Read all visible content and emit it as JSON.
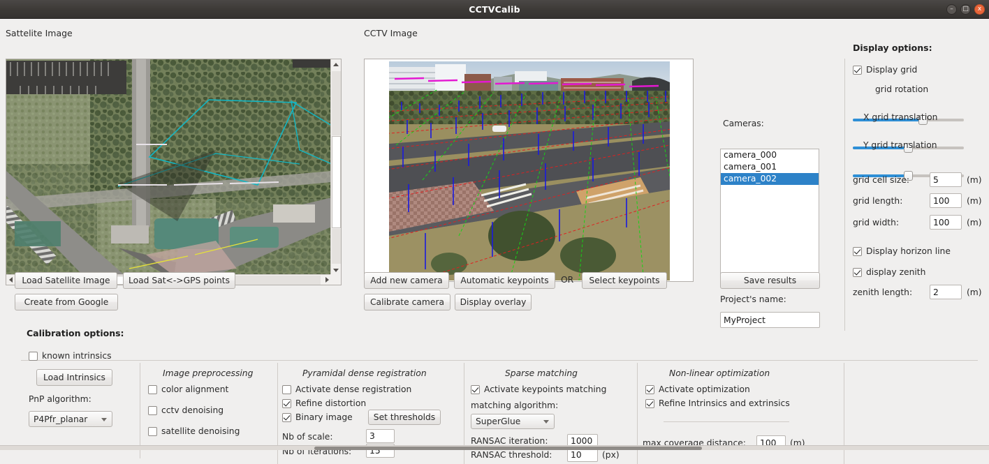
{
  "window": {
    "title": "CCTVCalib",
    "minimize_label": "–",
    "maximize_label": "□",
    "close_label": "x"
  },
  "satellite_panel": {
    "label": "Sattelite Image",
    "buttons": [
      {
        "name": "load-satellite-image-button",
        "label": "Load Satellite Image"
      },
      {
        "name": "load-sat-gps-points-button",
        "label": "Load Sat<->GPS points"
      },
      {
        "name": "create-from-google-button",
        "label": "Create from Google"
      }
    ]
  },
  "cctv_panel": {
    "label": "CCTV Image",
    "buttons": [
      {
        "name": "add-new-camera-button",
        "label": "Add new camera"
      },
      {
        "name": "automatic-keypoints-button",
        "label": "Automatic keypoints"
      },
      {
        "name": "select-keypoints-button",
        "label": "Select keypoints"
      },
      {
        "name": "calibrate-camera-button",
        "label": "Calibrate camera"
      },
      {
        "name": "display-overlay-button",
        "label": "Display overlay"
      }
    ],
    "or_text": "OR"
  },
  "cameras_panel": {
    "label": "Cameras:",
    "items": [
      {
        "label": "camera_000",
        "selected": false
      },
      {
        "label": "camera_001",
        "selected": false
      },
      {
        "label": "camera_002",
        "selected": true
      }
    ],
    "save_results_label": "Save results",
    "project_name_label": "Project's name:",
    "project_name_value": "MyProject"
  },
  "display_options": {
    "title": "Display options:",
    "display_grid": {
      "label": "Display grid",
      "checked": true
    },
    "grid_rotation": {
      "label": "grid rotation",
      "value_pct": 64
    },
    "x_grid_translation": {
      "label": "X grid translation",
      "value_pct": 51
    },
    "y_grid_translation": {
      "label": "Y grid translation",
      "value_pct": 51
    },
    "grid_cell_size": {
      "label": "grid cell size:",
      "value": "5",
      "unit": "(m)"
    },
    "grid_length": {
      "label": "grid length:",
      "value": "100",
      "unit": "(m)"
    },
    "grid_width": {
      "label": "grid width:",
      "value": "100",
      "unit": "(m)"
    },
    "display_horizon_line": {
      "label": "Display horizon line",
      "checked": true
    },
    "display_zenith": {
      "label": "display zenith",
      "checked": true
    },
    "zenith_length": {
      "label": "zenith length:",
      "value": "2",
      "unit": "(m)"
    }
  },
  "calibration_options": {
    "title": "Calibration options:",
    "known_intrinsics": {
      "label": "known intrinsics",
      "checked": false
    },
    "load_intrinsics_label": "Load Intrinsics",
    "pnp_algorithm_label": "PnP algorithm:",
    "pnp_algorithm_value": "P4Pfr_planar",
    "image_preprocessing": {
      "title": "Image preprocessing",
      "color_alignment": {
        "label": "color alignment",
        "checked": false
      },
      "cctv_denoising": {
        "label": "cctv denoising",
        "checked": false
      },
      "satellite_denoising": {
        "label": "satellite denoising",
        "checked": false
      }
    },
    "pyramidal_dense_registration": {
      "title": "Pyramidal dense registration",
      "activate_dense_registration": {
        "label": "Activate dense registration",
        "checked": false
      },
      "refine_distortion": {
        "label": "Refine distortion",
        "checked": true
      },
      "binary_image": {
        "label": "Binary image",
        "checked": true
      },
      "set_thresholds_label": "Set thresholds",
      "nb_of_scale": {
        "label": "Nb of scale:",
        "value": "3"
      },
      "nb_of_iterations": {
        "label": "Nb of iterations:",
        "value": "15"
      }
    },
    "sparse_matching": {
      "title": "Sparse matching",
      "activate_keypoints_matching": {
        "label": "Activate keypoints matching",
        "checked": true
      },
      "matching_algorithm_label": "matching algorithm:",
      "matching_algorithm_value": "SuperGlue",
      "ransac_iteration": {
        "label": "RANSAC iteration:",
        "value": "1000"
      },
      "ransac_threshold": {
        "label": "RANSAC threshold:",
        "value": "10",
        "unit": "(px)"
      }
    },
    "non_linear_optimization": {
      "title": "Non-linear optimization",
      "activate_optimization": {
        "label": "Activate optimization",
        "checked": true
      },
      "refine_intrinsics_and_extrinsics": {
        "label": "Refine Intrinsics and extrinsics",
        "checked": true
      },
      "max_coverage_distance": {
        "label": "max coverage distance:",
        "value": "100",
        "unit": "(m)"
      }
    }
  },
  "colors": {
    "accent_blue": "#2d82c8",
    "slider_fill": "#2e8fd6",
    "window_bg": "#f0efee",
    "titlebar": "#3c3936",
    "close_button": "#e8663a"
  }
}
